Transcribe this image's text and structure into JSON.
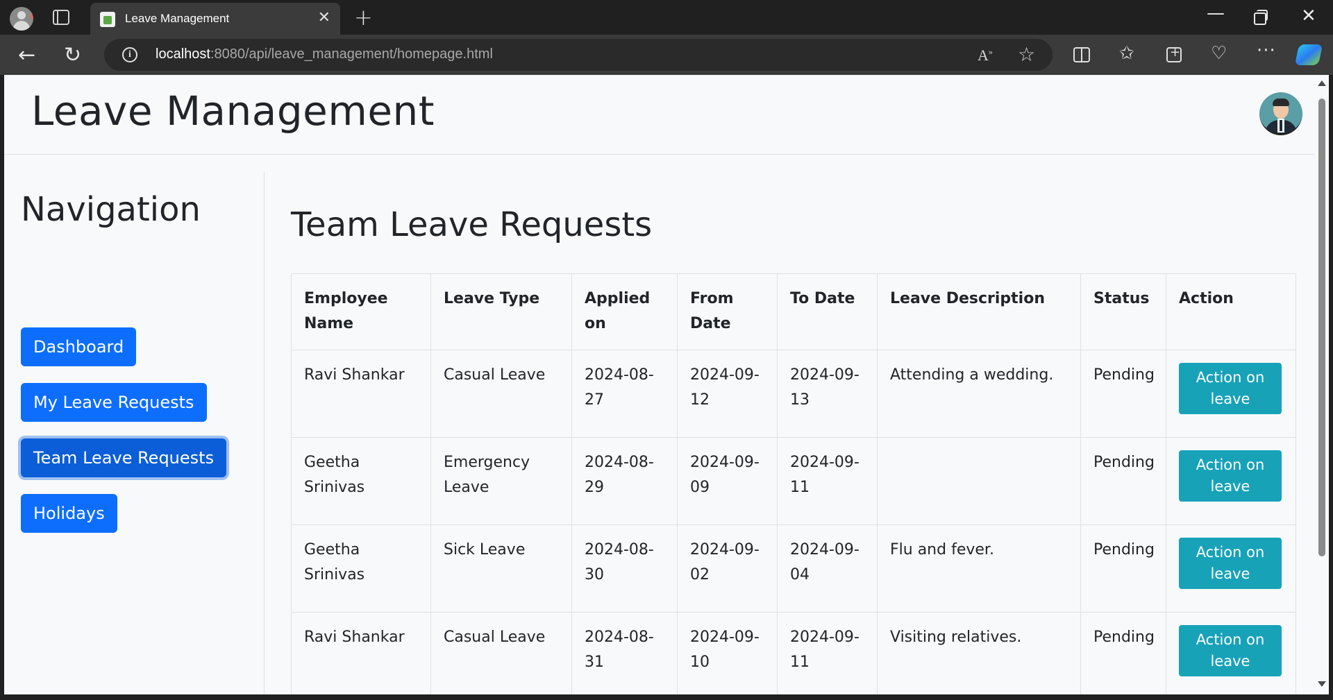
{
  "browser": {
    "tab_title": "Leave Management",
    "url_host": "localhost",
    "url_rest": ":8080/api/leave_management/homepage.html"
  },
  "header": {
    "brand": "Leave Management"
  },
  "sidebar": {
    "title": "Navigation",
    "items": [
      {
        "label": "Dashboard"
      },
      {
        "label": "My Leave Requests"
      },
      {
        "label": "Team Leave Requests"
      },
      {
        "label": "Holidays"
      }
    ]
  },
  "main": {
    "title": "Team Leave Requests",
    "columns": [
      "Employee Name",
      "Leave Type",
      "Applied on",
      "From Date",
      "To Date",
      "Leave Description",
      "Status",
      "Action"
    ],
    "rows": [
      {
        "employee": "Ravi Shankar",
        "type": "Casual Leave",
        "applied": "2024-08-27",
        "from": "2024-09-12",
        "to": "2024-09-13",
        "description": "Attending a wedding.",
        "status": "Pending",
        "action": "Action on leave"
      },
      {
        "employee": "Geetha Srinivas",
        "type": "Emergency Leave",
        "applied": "2024-08-29",
        "from": "2024-09-09",
        "to": "2024-09-11",
        "description": "",
        "status": "Pending",
        "action": "Action on leave"
      },
      {
        "employee": "Geetha Srinivas",
        "type": "Sick Leave",
        "applied": "2024-08-30",
        "from": "2024-09-02",
        "to": "2024-09-04",
        "description": "Flu and fever.",
        "status": "Pending",
        "action": "Action on leave"
      },
      {
        "employee": "Ravi Shankar",
        "type": "Casual Leave",
        "applied": "2024-08-31",
        "from": "2024-09-10",
        "to": "2024-09-11",
        "description": "Visiting relatives.",
        "status": "Pending",
        "action": "Action on leave"
      }
    ]
  },
  "colors": {
    "primary": "#0d6efd",
    "primary_active": "#0b5ed7",
    "info": "#17a2b8",
    "page_bg": "#f8f9fa"
  }
}
